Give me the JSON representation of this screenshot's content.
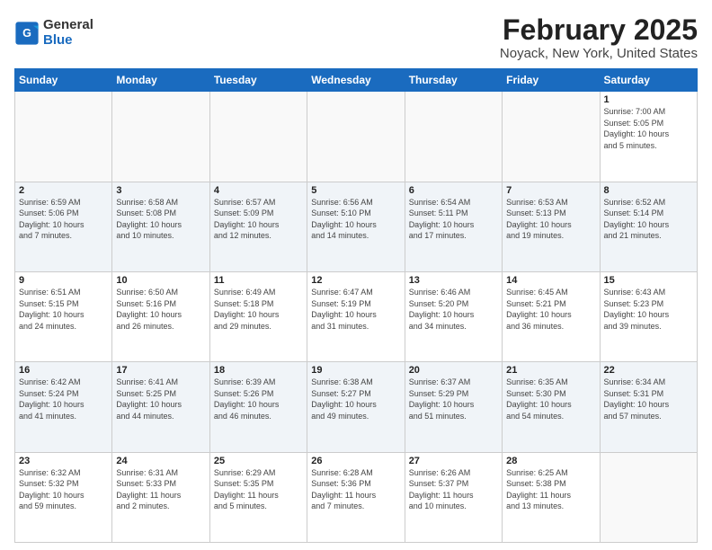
{
  "logo": {
    "general": "General",
    "blue": "Blue"
  },
  "title": "February 2025",
  "subtitle": "Noyack, New York, United States",
  "days_header": [
    "Sunday",
    "Monday",
    "Tuesday",
    "Wednesday",
    "Thursday",
    "Friday",
    "Saturday"
  ],
  "weeks": [
    [
      {
        "day": "",
        "info": ""
      },
      {
        "day": "",
        "info": ""
      },
      {
        "day": "",
        "info": ""
      },
      {
        "day": "",
        "info": ""
      },
      {
        "day": "",
        "info": ""
      },
      {
        "day": "",
        "info": ""
      },
      {
        "day": "1",
        "info": "Sunrise: 7:00 AM\nSunset: 5:05 PM\nDaylight: 10 hours\nand 5 minutes."
      }
    ],
    [
      {
        "day": "2",
        "info": "Sunrise: 6:59 AM\nSunset: 5:06 PM\nDaylight: 10 hours\nand 7 minutes."
      },
      {
        "day": "3",
        "info": "Sunrise: 6:58 AM\nSunset: 5:08 PM\nDaylight: 10 hours\nand 10 minutes."
      },
      {
        "day": "4",
        "info": "Sunrise: 6:57 AM\nSunset: 5:09 PM\nDaylight: 10 hours\nand 12 minutes."
      },
      {
        "day": "5",
        "info": "Sunrise: 6:56 AM\nSunset: 5:10 PM\nDaylight: 10 hours\nand 14 minutes."
      },
      {
        "day": "6",
        "info": "Sunrise: 6:54 AM\nSunset: 5:11 PM\nDaylight: 10 hours\nand 17 minutes."
      },
      {
        "day": "7",
        "info": "Sunrise: 6:53 AM\nSunset: 5:13 PM\nDaylight: 10 hours\nand 19 minutes."
      },
      {
        "day": "8",
        "info": "Sunrise: 6:52 AM\nSunset: 5:14 PM\nDaylight: 10 hours\nand 21 minutes."
      }
    ],
    [
      {
        "day": "9",
        "info": "Sunrise: 6:51 AM\nSunset: 5:15 PM\nDaylight: 10 hours\nand 24 minutes."
      },
      {
        "day": "10",
        "info": "Sunrise: 6:50 AM\nSunset: 5:16 PM\nDaylight: 10 hours\nand 26 minutes."
      },
      {
        "day": "11",
        "info": "Sunrise: 6:49 AM\nSunset: 5:18 PM\nDaylight: 10 hours\nand 29 minutes."
      },
      {
        "day": "12",
        "info": "Sunrise: 6:47 AM\nSunset: 5:19 PM\nDaylight: 10 hours\nand 31 minutes."
      },
      {
        "day": "13",
        "info": "Sunrise: 6:46 AM\nSunset: 5:20 PM\nDaylight: 10 hours\nand 34 minutes."
      },
      {
        "day": "14",
        "info": "Sunrise: 6:45 AM\nSunset: 5:21 PM\nDaylight: 10 hours\nand 36 minutes."
      },
      {
        "day": "15",
        "info": "Sunrise: 6:43 AM\nSunset: 5:23 PM\nDaylight: 10 hours\nand 39 minutes."
      }
    ],
    [
      {
        "day": "16",
        "info": "Sunrise: 6:42 AM\nSunset: 5:24 PM\nDaylight: 10 hours\nand 41 minutes."
      },
      {
        "day": "17",
        "info": "Sunrise: 6:41 AM\nSunset: 5:25 PM\nDaylight: 10 hours\nand 44 minutes."
      },
      {
        "day": "18",
        "info": "Sunrise: 6:39 AM\nSunset: 5:26 PM\nDaylight: 10 hours\nand 46 minutes."
      },
      {
        "day": "19",
        "info": "Sunrise: 6:38 AM\nSunset: 5:27 PM\nDaylight: 10 hours\nand 49 minutes."
      },
      {
        "day": "20",
        "info": "Sunrise: 6:37 AM\nSunset: 5:29 PM\nDaylight: 10 hours\nand 51 minutes."
      },
      {
        "day": "21",
        "info": "Sunrise: 6:35 AM\nSunset: 5:30 PM\nDaylight: 10 hours\nand 54 minutes."
      },
      {
        "day": "22",
        "info": "Sunrise: 6:34 AM\nSunset: 5:31 PM\nDaylight: 10 hours\nand 57 minutes."
      }
    ],
    [
      {
        "day": "23",
        "info": "Sunrise: 6:32 AM\nSunset: 5:32 PM\nDaylight: 10 hours\nand 59 minutes."
      },
      {
        "day": "24",
        "info": "Sunrise: 6:31 AM\nSunset: 5:33 PM\nDaylight: 11 hours\nand 2 minutes."
      },
      {
        "day": "25",
        "info": "Sunrise: 6:29 AM\nSunset: 5:35 PM\nDaylight: 11 hours\nand 5 minutes."
      },
      {
        "day": "26",
        "info": "Sunrise: 6:28 AM\nSunset: 5:36 PM\nDaylight: 11 hours\nand 7 minutes."
      },
      {
        "day": "27",
        "info": "Sunrise: 6:26 AM\nSunset: 5:37 PM\nDaylight: 11 hours\nand 10 minutes."
      },
      {
        "day": "28",
        "info": "Sunrise: 6:25 AM\nSunset: 5:38 PM\nDaylight: 11 hours\nand 13 minutes."
      },
      {
        "day": "",
        "info": ""
      }
    ]
  ]
}
